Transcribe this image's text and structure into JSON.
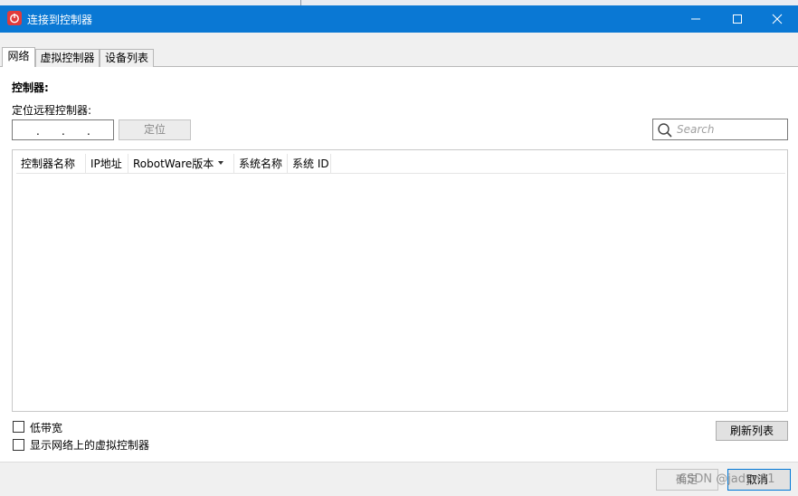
{
  "window": {
    "title": "连接到控制器",
    "controls": {
      "minimize_icon": "minimize-icon",
      "maximize_icon": "maximize-icon",
      "close_icon": "close-icon"
    }
  },
  "tabs": [
    {
      "label": "网络",
      "active": true
    },
    {
      "label": "虚拟控制器",
      "active": false
    },
    {
      "label": "设备列表",
      "active": false
    }
  ],
  "network": {
    "controller_heading": "控制器:",
    "locate_label": "定位远程控制器:",
    "ip_address": {
      "separator": "."
    },
    "locate_button": "定位",
    "search": {
      "placeholder": "Search",
      "icon": "search-icon"
    },
    "table": {
      "columns": [
        "控制器名称",
        "IP地址",
        "RobotWare版本",
        "系统名称",
        "系统 ID"
      ],
      "rows": []
    },
    "options": [
      {
        "label": "低带宽",
        "checked": false
      },
      {
        "label": "显示网络上的虚拟控制器",
        "checked": false
      }
    ],
    "refresh_button": "刷新列表"
  },
  "footer": {
    "ok_button": "确定",
    "cancel_button": "取消",
    "watermark": "CSDN @jadyn01"
  },
  "colors": {
    "titlebar": "#0a78d4",
    "app_icon": "#e13b3b"
  }
}
